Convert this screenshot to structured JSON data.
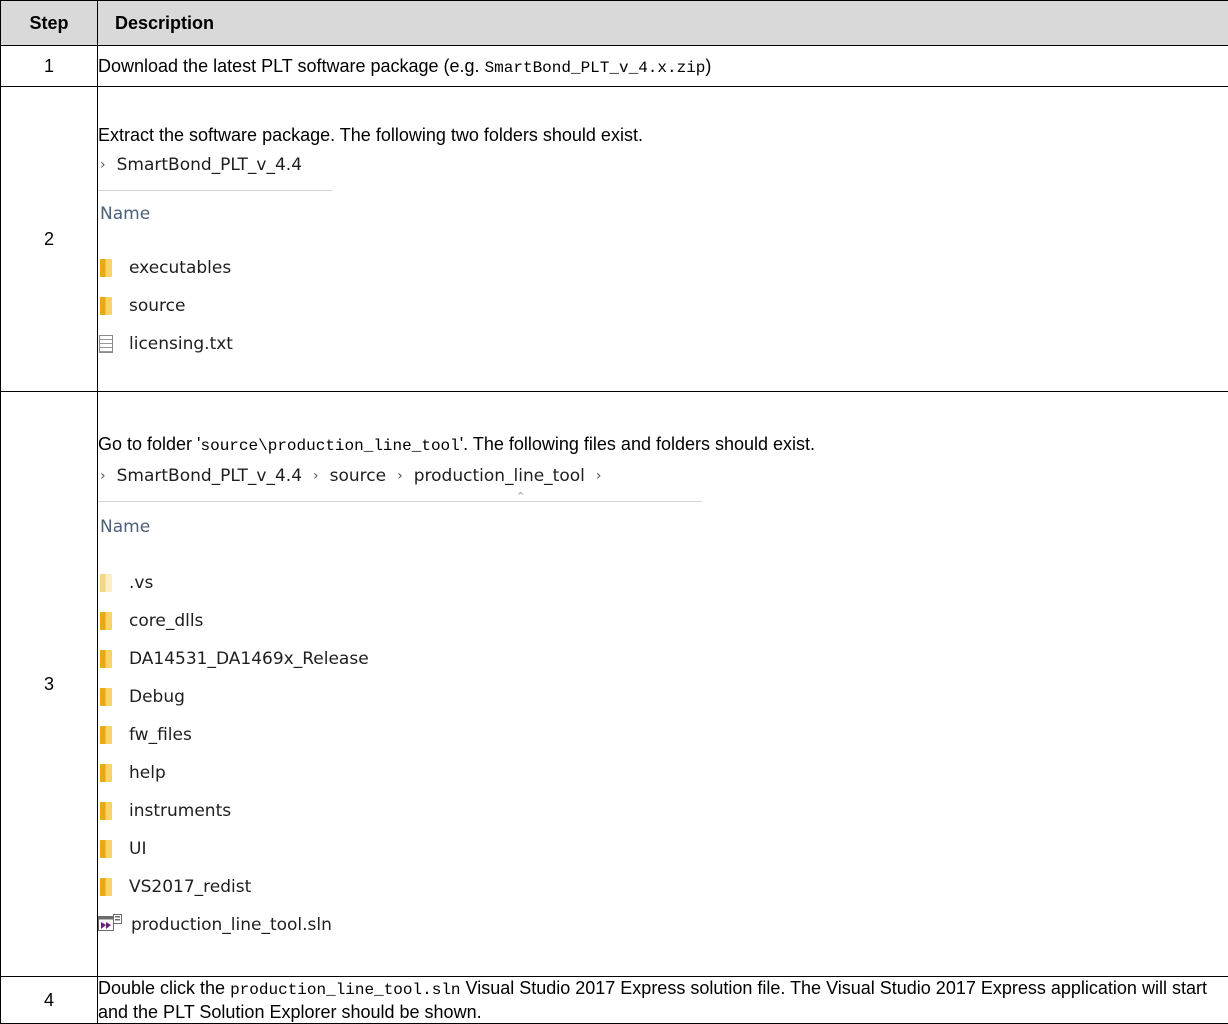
{
  "table": {
    "header": {
      "step": "Step",
      "description": "Description"
    },
    "rows": [
      {
        "step": "1",
        "text_before": "Download the latest PLT software package (e.g. ",
        "code": "SmartBond_PLT_v_4.x.zip",
        "text_after": ")"
      },
      {
        "step": "2",
        "text": "Extract the software package. The following two folders should exist.",
        "explorer": {
          "breadcrumb": [
            "SmartBond_PLT_v_4.4"
          ],
          "column_header": "Name",
          "items": [
            {
              "name": "executables",
              "icon": "folder-icon"
            },
            {
              "name": "source",
              "icon": "folder-icon"
            },
            {
              "name": "licensing.txt",
              "icon": "text-file-icon"
            }
          ]
        }
      },
      {
        "step": "3",
        "text_before": "Go to folder '",
        "code": "source\\production_line_tool",
        "text_after": "'. The following files and folders should exist.",
        "explorer": {
          "breadcrumb": [
            "SmartBond_PLT_v_4.4",
            "source",
            "production_line_tool"
          ],
          "column_header": "Name",
          "items": [
            {
              "name": ".vs",
              "icon": "hidden-folder-icon"
            },
            {
              "name": "core_dlls",
              "icon": "folder-icon"
            },
            {
              "name": "DA14531_DA1469x_Release",
              "icon": "folder-icon"
            },
            {
              "name": "Debug",
              "icon": "folder-icon"
            },
            {
              "name": "fw_files",
              "icon": "folder-icon"
            },
            {
              "name": "help",
              "icon": "folder-icon"
            },
            {
              "name": "instruments",
              "icon": "folder-icon"
            },
            {
              "name": "UI",
              "icon": "folder-icon"
            },
            {
              "name": "VS2017_redist",
              "icon": "folder-icon"
            },
            {
              "name": "production_line_tool.sln",
              "icon": "visual-studio-solution-icon"
            }
          ]
        }
      },
      {
        "step": "4",
        "text_before": "Double click the ",
        "code": "production_line_tool.sln",
        "text_after": " Visual Studio 2017 Express solution file. The Visual Studio 2017 Express application will start and the PLT Solution Explorer should be shown."
      }
    ]
  }
}
